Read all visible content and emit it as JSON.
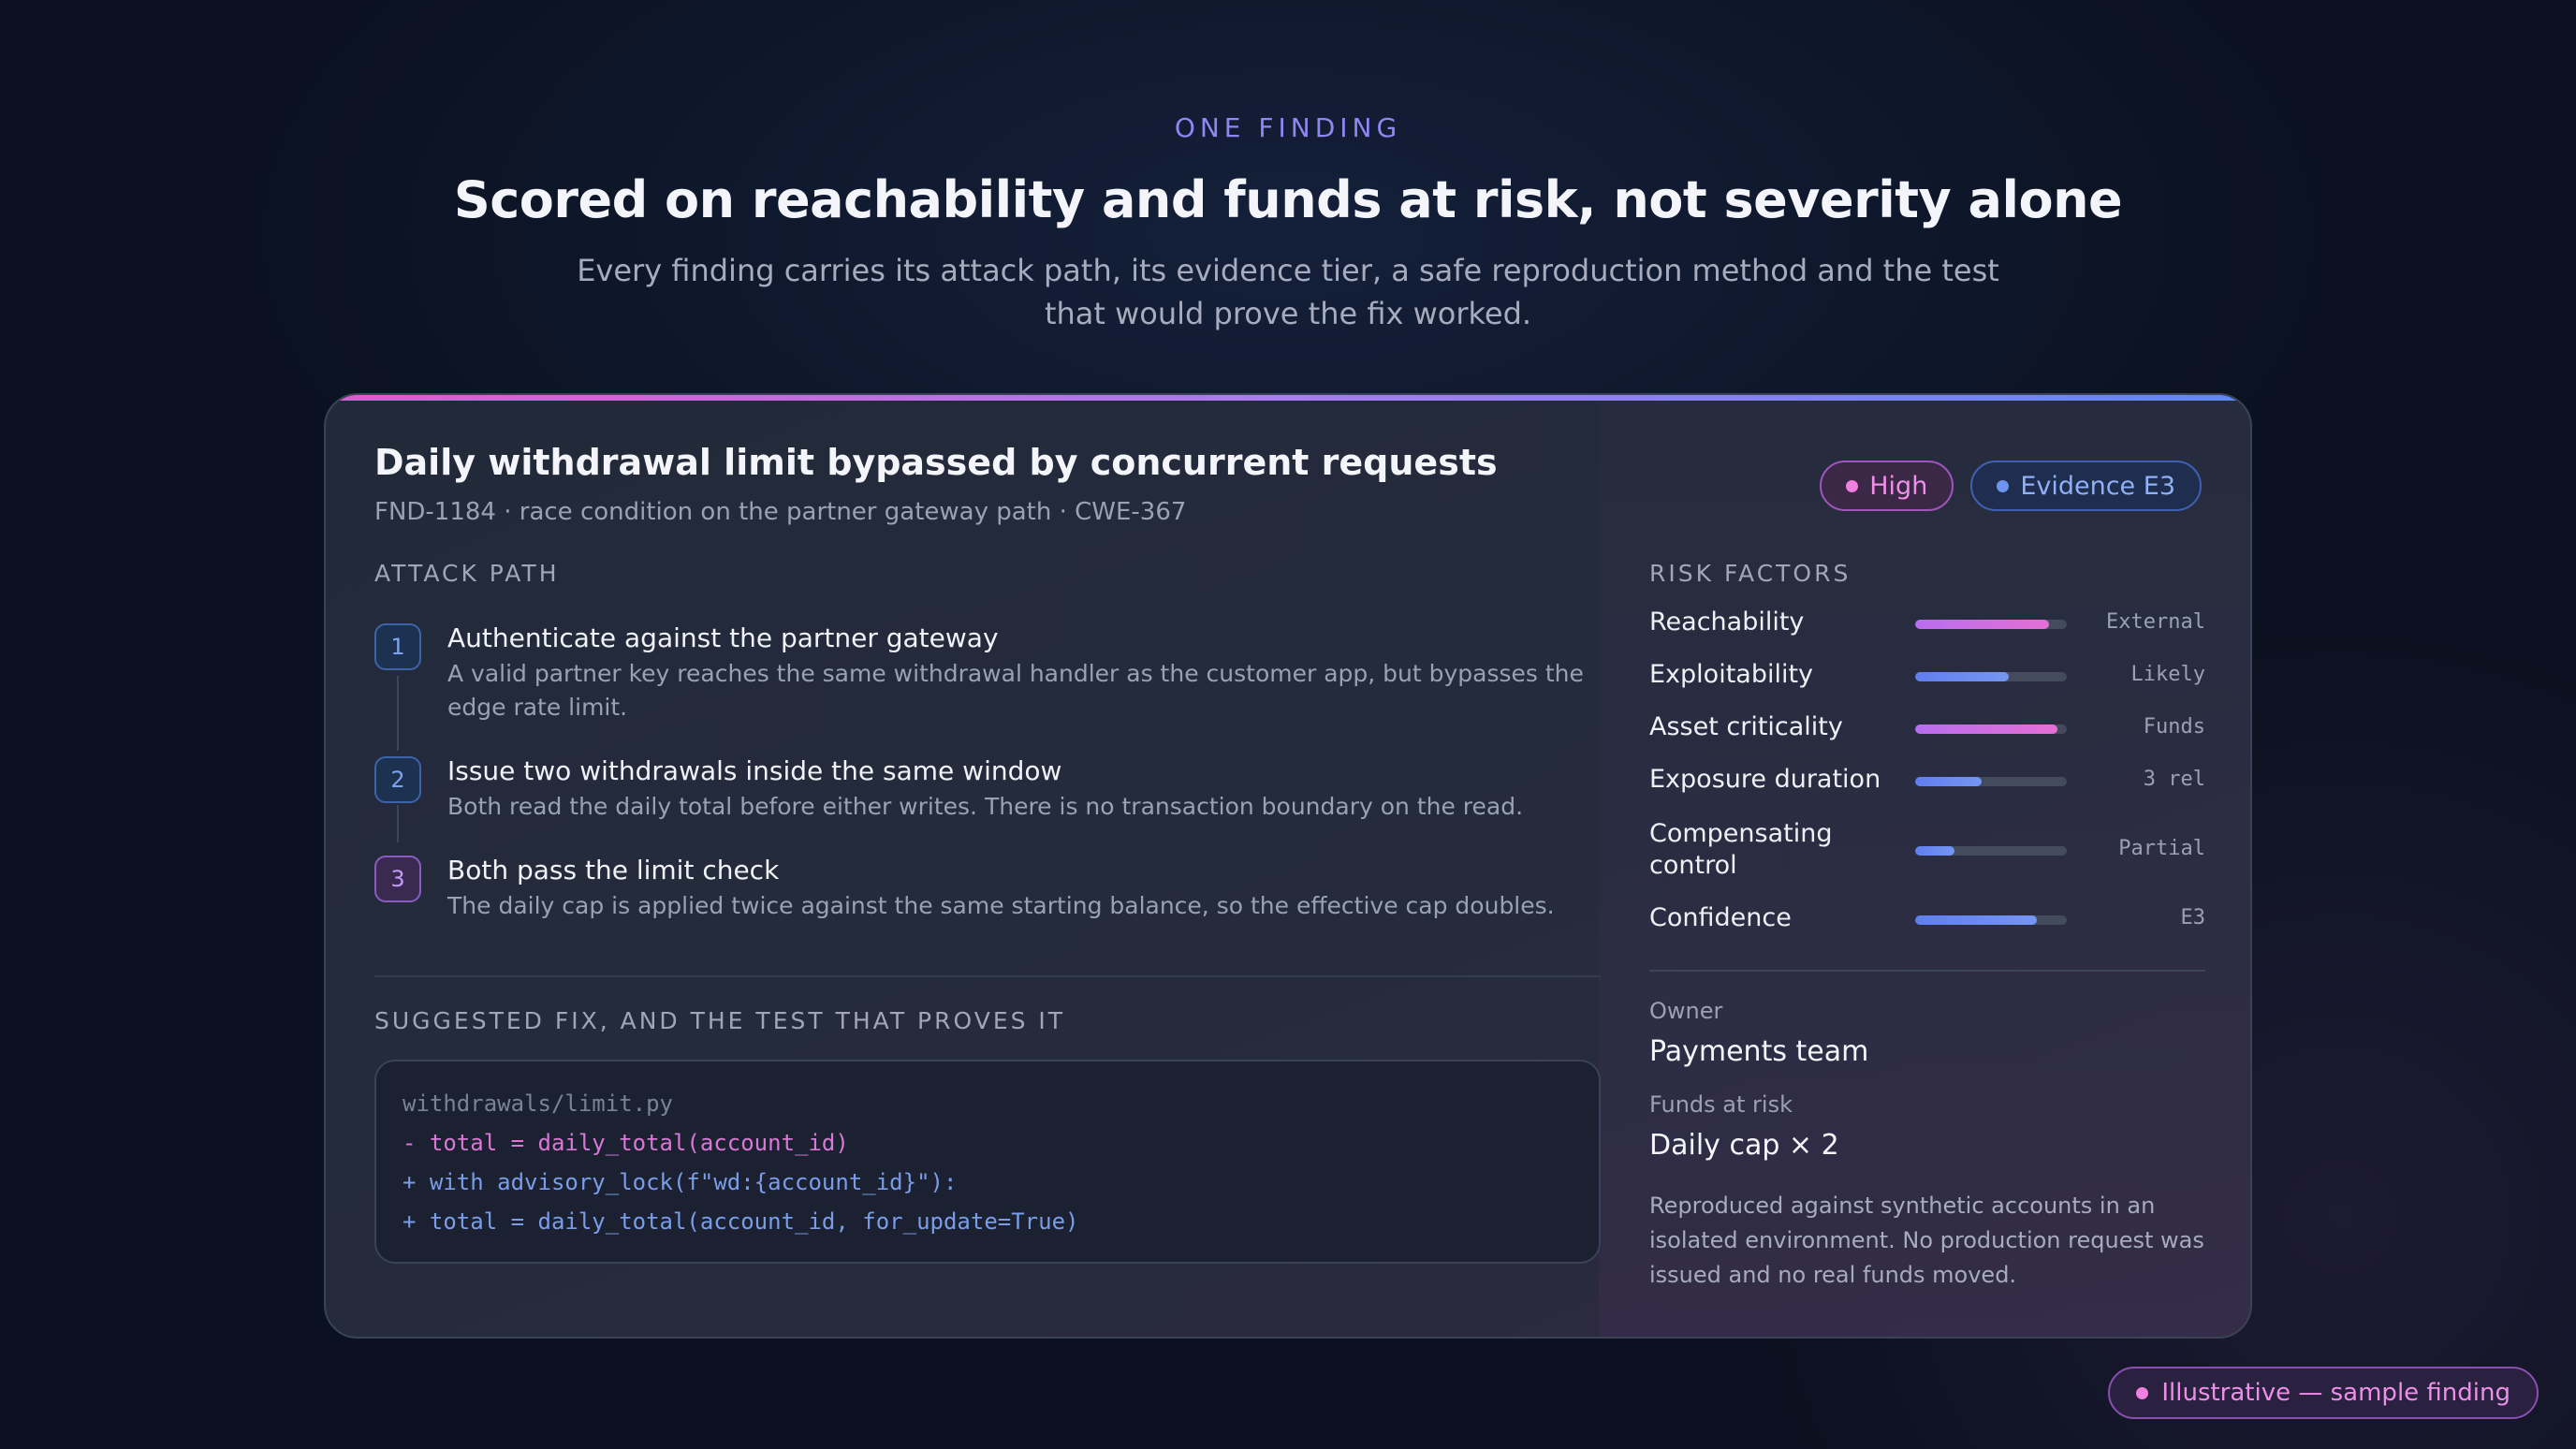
{
  "hero": {
    "eyebrow": "ONE FINDING",
    "headline": "Scored on reachability and funds at risk, not severity alone",
    "lede": "Every finding carries its attack path, its evidence tier, a safe reproduction method and the test that would prove the fix worked."
  },
  "finding": {
    "title": "Daily withdrawal limit bypassed by concurrent requests",
    "subtitle": "FND-1184 · race condition on the partner gateway path · CWE-367",
    "badges": {
      "severity": "High",
      "evidence": "Evidence E3"
    },
    "attack_path": {
      "label": "ATTACK PATH",
      "steps": [
        {
          "num": "1",
          "title": "Authenticate against the partner gateway",
          "desc": "A valid partner key reaches the same withdrawal handler as the customer app, but bypasses the edge rate limit."
        },
        {
          "num": "2",
          "title": "Issue two withdrawals inside the same window",
          "desc": "Both read the daily total before either writes. There is no transaction boundary on the read."
        },
        {
          "num": "3",
          "title": "Both pass the limit check",
          "desc": "The daily cap is applied twice against the same starting balance, so the effective cap doubles."
        }
      ]
    },
    "fix": {
      "label": "SUGGESTED FIX, AND THE TEST THAT PROVES IT",
      "file": "withdrawals/limit.py",
      "lines": [
        "- total = daily_total(account_id)",
        "+ with advisory_lock(f\"wd:{account_id}\"):",
        "+ total = daily_total(account_id, for_update=True)"
      ]
    },
    "risk_factors": {
      "label": "RISK FACTORS",
      "items": [
        {
          "name": "Reachability",
          "value": "External",
          "level": 0.88,
          "color": "#d86fe0"
        },
        {
          "name": "Exploitability",
          "value": "Likely",
          "level": 0.62,
          "color": "#6f8ff0"
        },
        {
          "name": "Asset criticality",
          "value": "Funds",
          "level": 0.94,
          "color": "#d86fe0"
        },
        {
          "name": "Exposure duration",
          "value": "3 rel",
          "level": 0.44,
          "color": "#6f8ff0"
        },
        {
          "name": "Compensating control",
          "value": "Partial",
          "level": 0.26,
          "color": "#6f8ff0"
        },
        {
          "name": "Confidence",
          "value": "E3",
          "level": 0.8,
          "color": "#6f8ff0"
        }
      ]
    },
    "owner": {
      "label": "Owner",
      "value": "Payments team"
    },
    "funds": {
      "label": "Funds at risk",
      "value": "Daily cap × 2"
    },
    "note": "Reproduced against synthetic accounts in an isolated environment. No production request was issued and no real funds moved."
  },
  "footer": {
    "badge": "Illustrative — sample finding"
  }
}
